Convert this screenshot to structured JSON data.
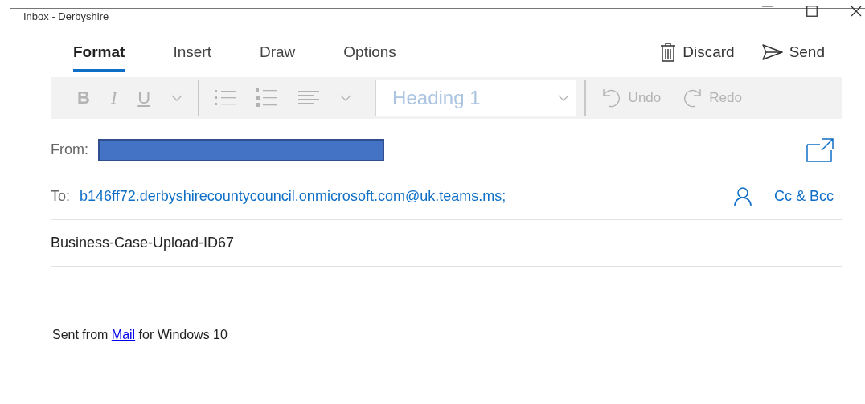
{
  "window": {
    "title": "Inbox - Derbyshire"
  },
  "tabs": [
    {
      "label": "Format",
      "selected": true
    },
    {
      "label": "Insert",
      "selected": false
    },
    {
      "label": "Draw",
      "selected": false
    },
    {
      "label": "Options",
      "selected": false
    }
  ],
  "actions": [
    {
      "kind": "discard",
      "label": "Discard"
    },
    {
      "kind": "send",
      "label": "Send"
    }
  ],
  "toolbar": [
    {
      "kind": "bold",
      "label": "B",
      "disabled": true
    },
    {
      "kind": "italic",
      "label": "I",
      "disabled": true
    },
    {
      "kind": "underline",
      "label": "U",
      "disabled": true
    },
    {
      "kind": "chevron",
      "disabled": true
    },
    {
      "kind": "separator"
    },
    {
      "kind": "bullets",
      "disabled": true
    },
    {
      "kind": "numbering",
      "disabled": true
    },
    {
      "kind": "align",
      "disabled": true
    },
    {
      "kind": "chevron",
      "disabled": true
    },
    {
      "kind": "separator"
    },
    {
      "kind": "style",
      "value": "Heading 1",
      "disabled": true
    },
    {
      "kind": "separator"
    },
    {
      "kind": "undo",
      "label": "Undo",
      "disabled": true
    },
    {
      "kind": "redo",
      "label": "Redo",
      "disabled": true
    }
  ],
  "from": {
    "label": "From:",
    "redacted": true
  },
  "to": {
    "label": "To:",
    "value": "b146ff72.derbyshirecountycouncil.onmicrosoft.com@uk.teams.ms;",
    "cc_bcc": "Cc & Bcc"
  },
  "subject": {
    "value": "Business-Case-Upload-ID67"
  },
  "body": {
    "before": "Sent from ",
    "link": "Mail",
    "after": " for Windows 10"
  }
}
